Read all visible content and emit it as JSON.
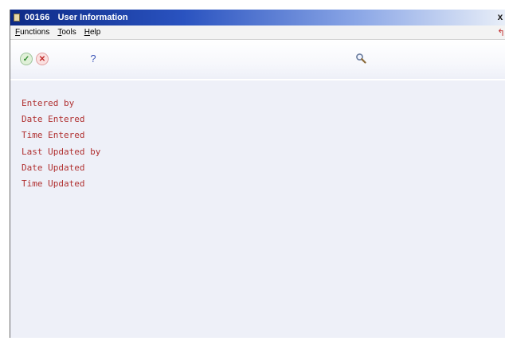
{
  "window": {
    "number": "00166",
    "title": "User Information",
    "close_label": "x"
  },
  "menu": {
    "items": [
      {
        "label": "Functions",
        "accel": "F"
      },
      {
        "label": "Tools",
        "accel": "T"
      },
      {
        "label": "Help",
        "accel": "H"
      }
    ]
  },
  "toolbar": {
    "ok_label": "✓",
    "cancel_label": "✕",
    "help_label": "?"
  },
  "icons": {
    "ok": "checkmark-icon",
    "cancel": "x-icon",
    "help": "question-icon",
    "search": "magnifier-icon",
    "exit": "exit-arrow-icon"
  },
  "fields": [
    "Entered by",
    "Date Entered",
    "Time Entered",
    "Last Updated by",
    "Date Updated",
    "Time Updated"
  ],
  "colors": {
    "title_bar": "#1a3fa0",
    "field_label": "#b03030",
    "background": "#eef0f8"
  }
}
